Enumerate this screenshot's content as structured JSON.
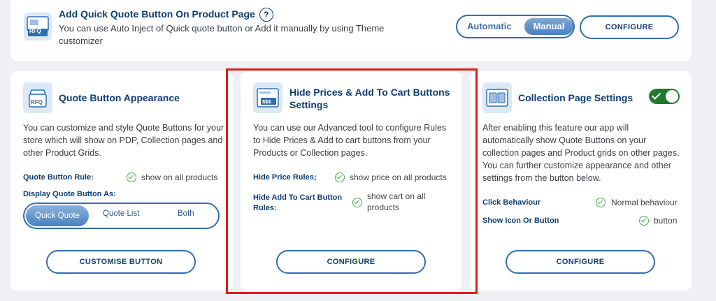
{
  "top": {
    "title": "Add Quick Quote Button On Product Page",
    "help": "?",
    "desc_line1": "You can use Auto Inject of Quick quote button or Add it manually by using Theme",
    "desc_line2": "customizer",
    "mode_auto": "Automatic",
    "mode_manual": "Manual",
    "configure": "CONFIGURE",
    "icon_text": "RFQ"
  },
  "appearance": {
    "title": "Quote Button Appearance",
    "icon_text": "RFQ",
    "desc": [
      "You can customize and style Quote Buttons for your",
      "store which will show on PDP, Collection pages and",
      "other Product Grids."
    ],
    "rule_label": "Quote Button Rule:",
    "rule_value": "show on all products",
    "display_label": "Display Quote Button As:",
    "options": [
      "Quick Quote",
      "Quote List",
      "Both"
    ],
    "selected": "Quick Quote",
    "button": "CUSTOMISE BUTTON"
  },
  "hide_prices": {
    "title_line1": "Hide Prices & Add To Cart Buttons",
    "title_line2": "Settings",
    "icon_text": "$$$",
    "desc": [
      "You can use our Advanced tool to configure Rules",
      "to Hide Prices & Add to cart buttons from your",
      "Products or Collection pages."
    ],
    "price_label": "Hide Price Rules;",
    "price_value": "show price on all products",
    "cart_label_line1": "Hide Add To Cart Button",
    "cart_label_line2": "Rules:",
    "cart_value_line1": "show cart on all",
    "cart_value_line2": "products",
    "button": "CONFIGURE"
  },
  "collection": {
    "title": "Collection Page Settings",
    "enabled": true,
    "desc": [
      "After enabling this feature our app will",
      "automatically show Quote Buttons on your",
      "collection pages and Product grids on other pages.",
      "You can further customize appearance and other",
      "settings from the button below."
    ],
    "click_label": "Click Behaviour",
    "click_value": "Normal behaviour",
    "show_label": "Show Icon Or Button",
    "show_value": "button",
    "button": "CONFIGURE"
  },
  "colors": {
    "accent": "#2f6db3",
    "heading": "#0d3d73",
    "toggle_on": "#1f7a2e",
    "highlight": "#e01b1b"
  }
}
